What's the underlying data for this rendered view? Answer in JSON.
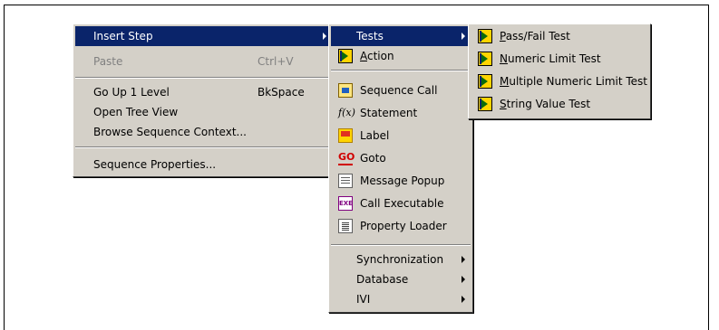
{
  "context_menu": {
    "items": [
      {
        "label": "Insert Step",
        "shortcut": "",
        "submenu": true,
        "selected": true,
        "disabled": false
      },
      {
        "label": "Paste",
        "shortcut": "Ctrl+V",
        "submenu": false,
        "selected": false,
        "disabled": true
      },
      {
        "label": "Go Up 1 Level",
        "shortcut": "BkSpace",
        "submenu": false,
        "selected": false,
        "disabled": false
      },
      {
        "label": "Open Tree View",
        "shortcut": "",
        "submenu": false,
        "selected": false,
        "disabled": false
      },
      {
        "label": "Browse Sequence Context...",
        "shortcut": "",
        "submenu": false,
        "selected": false,
        "disabled": false
      },
      {
        "label": "Sequence Properties...",
        "shortcut": "",
        "submenu": false,
        "selected": false,
        "disabled": false
      }
    ]
  },
  "insert_step_menu": {
    "items": [
      {
        "label": "Tests",
        "icon": "",
        "submenu": true,
        "selected": true
      },
      {
        "label_pre": "",
        "label_ul": "A",
        "label_post": "ction",
        "icon": "teststand-step-icon"
      },
      {
        "label": "Sequence Call",
        "icon": "sequence-call-icon"
      },
      {
        "label": "Statement",
        "icon": "fx-icon"
      },
      {
        "label": "Label",
        "icon": "label-icon"
      },
      {
        "label": "Goto",
        "icon": "goto-icon"
      },
      {
        "label": "Message Popup",
        "icon": "message-popup-icon"
      },
      {
        "label": "Call Executable",
        "icon": "exe-icon"
      },
      {
        "label": "Property Loader",
        "icon": "property-loader-icon"
      },
      {
        "label": "Synchronization",
        "submenu": true
      },
      {
        "label": "Database",
        "submenu": true
      },
      {
        "label": "IVI",
        "submenu": true
      }
    ]
  },
  "tests_menu": {
    "items": [
      {
        "label_ul": "P",
        "label_post": "ass/Fail Test",
        "icon": "teststand-step-icon"
      },
      {
        "label_ul": "N",
        "label_post": "umeric Limit Test",
        "icon": "teststand-step-icon"
      },
      {
        "label_ul": "M",
        "label_post": "ultiple Numeric Limit Test",
        "icon": "teststand-step-icon"
      },
      {
        "label_ul": "S",
        "label_post": "tring Value Test",
        "icon": "teststand-step-icon"
      }
    ]
  },
  "icon_glyphs": {
    "statement": "f(x)",
    "goto": "GO",
    "exe": "EXE"
  },
  "colors": {
    "menu_bg": "#d4d0c8",
    "highlight": "#0a246a",
    "disabled_text": "#808080"
  }
}
